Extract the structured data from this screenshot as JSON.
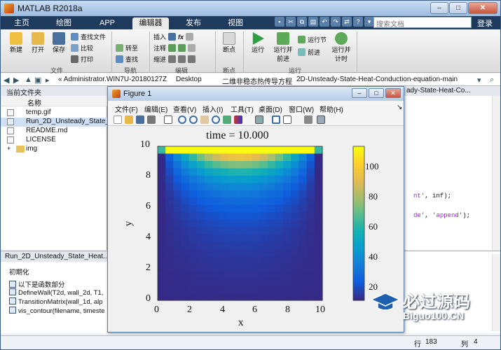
{
  "app": {
    "title": "MATLAB R2018a"
  },
  "tabs": [
    {
      "label": "主页"
    },
    {
      "label": "绘图"
    },
    {
      "label": "APP"
    },
    {
      "label": "编辑器"
    },
    {
      "label": "发布"
    },
    {
      "label": "视图"
    }
  ],
  "search": {
    "placeholder": "搜索文档"
  },
  "login": "登录",
  "ribbon": {
    "new": "新建",
    "open": "打开",
    "save": "保存",
    "find_files": "查找文件",
    "compare": "比较",
    "print": "打印",
    "goto": "转至",
    "find": "查找",
    "insert": "插入",
    "comment": "注释",
    "indent": "缩进",
    "breakpoints": "断点",
    "run": "运行",
    "run_advance": "运行并前进",
    "run_section": "运行节",
    "advance": "前进",
    "run_time": "运行并计时",
    "groups": {
      "file": "文件",
      "nav": "导航",
      "edit": "编辑",
      "bp": "断点",
      "run": "运行"
    }
  },
  "address": {
    "segments": [
      "« Administrator.WIN7U-20180127Z",
      "Desktop",
      "二维非稳态热传导方程",
      "2D-Unsteady-State-Heat-Conduction-equation-main"
    ]
  },
  "folder": {
    "header": "当前文件夹",
    "column": "名称",
    "files": [
      "temp.gif",
      "Run_2D_Unsteady_State_He...",
      "README.md",
      "LICENSE",
      "img"
    ]
  },
  "details": {
    "header": "Run_2D_Unsteady_State_Heat...",
    "title": "初期化",
    "items": [
      "以下是函数部分",
      "DefineWall(T2d, wall_2d, T1,",
      "TransitionMatrix(wall_1d, alp",
      "vis_contour(filename, timeste"
    ]
  },
  "editor": {
    "tab": "ady-State-Heat-Co...",
    "lines": [
      {
        "pre": "nt'",
        "rest": ", inf);"
      },
      {
        "pre": "de'",
        "mid": ", ",
        "str2": "'append'",
        "rest": ");"
      }
    ]
  },
  "status": {
    "line_label": "行",
    "line": "183",
    "col_label": "列",
    "col": "4"
  },
  "figure": {
    "title": "Figure 1",
    "menu": [
      "文件(F)",
      "编辑(E)",
      "查看(V)",
      "插入(I)",
      "工具(T)",
      "桌面(D)",
      "窗口(W)",
      "帮助(H)"
    ],
    "plot_title": "time = 10.000",
    "xlabel": "x",
    "ylabel": "y"
  },
  "chart_data": {
    "type": "heatmap",
    "title": "time = 10.000",
    "xlabel": "x",
    "ylabel": "y",
    "xlim": [
      0,
      10
    ],
    "ylim": [
      0,
      10
    ],
    "xticks": [
      "0",
      "2",
      "4",
      "6",
      "8",
      "10"
    ],
    "yticks": [
      "0",
      "2",
      "4",
      "6",
      "8",
      "10"
    ],
    "colorbar": {
      "ticks": [
        "20",
        "40",
        "60",
        "80",
        "100"
      ],
      "range": [
        0,
        100
      ],
      "colormap": "parula"
    },
    "grid_size": [
      21,
      21
    ],
    "description_of_field": "temperature field with top boundary at 100 and other boundaries at 0"
  },
  "watermark": {
    "cn": "必过源码",
    "en": "Biguo100.CN"
  },
  "colors": {
    "tab_bar": "#1e3b5e",
    "accent": "#3a5f88"
  }
}
